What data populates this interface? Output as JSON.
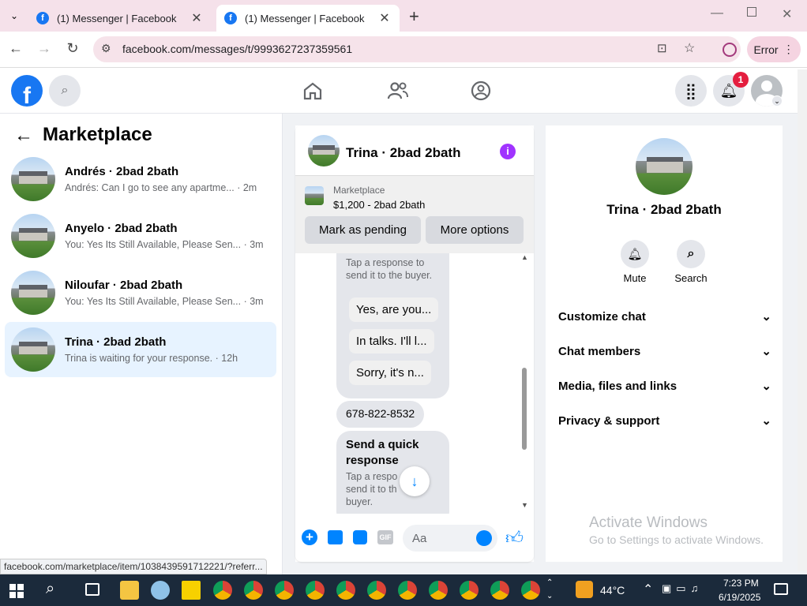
{
  "browser": {
    "tabs": [
      {
        "title": "(1) Messenger | Facebook"
      },
      {
        "title": "(1) Messenger | Facebook"
      }
    ],
    "url": "facebook.com/messages/t/9993627237359561",
    "error_label": "Error",
    "status_url": "facebook.com/marketplace/item/1038439591712221/?referr..."
  },
  "header": {
    "notifications_count": "1",
    "brand_color": "#1877f2"
  },
  "left_panel": {
    "title": "Marketplace",
    "conversations": [
      {
        "name": "Andrés · 2bad 2bath",
        "preview": "Andrés: Can I go to see any apartme...",
        "time": "· 2m"
      },
      {
        "name": "Anyelo · 2bad 2bath",
        "preview": "You: Yes Its Still Available, Please Sen...",
        "time": "· 3m"
      },
      {
        "name": "Niloufar · 2bad 2bath",
        "preview": "You: Yes Its Still Available, Please Sen...",
        "time": "· 3m"
      },
      {
        "name": "Trina · 2bad 2bath",
        "preview": "Trina is waiting for your response.",
        "time": "· 12h"
      }
    ]
  },
  "chat": {
    "title": "Trina · 2bad 2bath",
    "listing_label": "Marketplace",
    "listing_price": "$1,200 - 2bad 2bath",
    "mark_pending": "Mark as pending",
    "more_options": "More options",
    "tap_hint": "Tap a response to send it to the buyer.",
    "quick_replies": [
      "Yes, are you...",
      "In talks. I'll l...",
      "Sorry, it's n..."
    ],
    "phone": "678-822-8532",
    "quick_response_title": "Send a quick response",
    "tap_hint2": "Tap a respo send it to th buyer.",
    "composer_placeholder": "Aa",
    "accent_color": "#0084ff"
  },
  "right_panel": {
    "name": "Trina · 2bad 2bath",
    "mute": "Mute",
    "search": "Search",
    "sections": [
      "Customize chat",
      "Chat members",
      "Media, files and links",
      "Privacy & support"
    ],
    "watermark_title": "Activate Windows",
    "watermark_sub": "Go to Settings to activate Windows."
  },
  "taskbar": {
    "temperature": "44°C",
    "time": "7:23 PM",
    "date": "6/19/2025"
  }
}
